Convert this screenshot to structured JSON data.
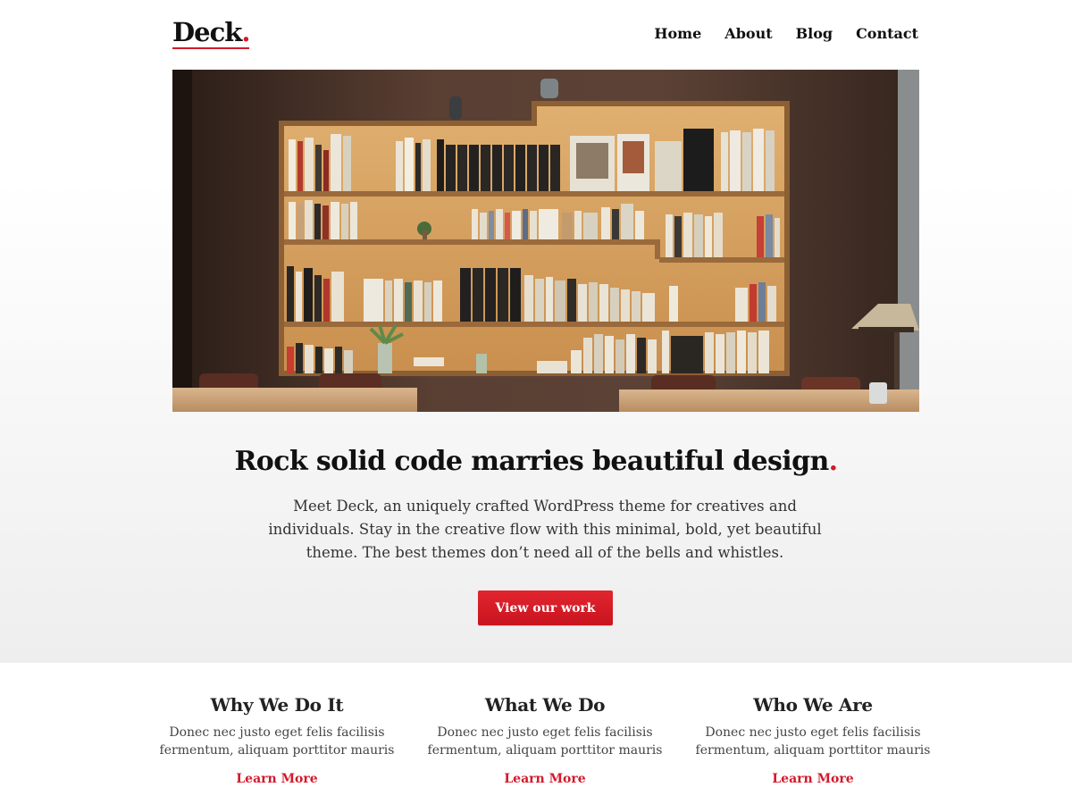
{
  "header": {
    "logo_text": "Deck",
    "logo_dot": ".",
    "nav": [
      {
        "label": "Home"
      },
      {
        "label": "About"
      },
      {
        "label": "Blog"
      },
      {
        "label": "Contact"
      }
    ]
  },
  "hero": {
    "image_alt": "bookshelf photo",
    "headline": "Rock solid code marries beautiful design",
    "headline_dot": ".",
    "intro": "Meet Deck, an uniquely crafted WordPress theme for creatives and individuals. Stay in the creative flow with this minimal, bold, yet beautiful theme. The best themes don’t need all of the bells and whistles.",
    "cta_label": "View our work"
  },
  "features": [
    {
      "title": "Why We Do It",
      "text": "Donec nec justo eget felis facilisis fermentum, aliquam porttitor mauris",
      "link": "Learn More"
    },
    {
      "title": "What We Do",
      "text": "Donec nec justo eget felis facilisis fermentum, aliquam porttitor mauris",
      "link": "Learn More"
    },
    {
      "title": "Who We Are",
      "text": "Donec nec justo eget felis facilisis fermentum, aliquam porttitor mauris",
      "link": "Learn More"
    }
  ],
  "colors": {
    "accent": "#d3192b",
    "text": "#111111",
    "background_fade": "#eeeeee"
  }
}
